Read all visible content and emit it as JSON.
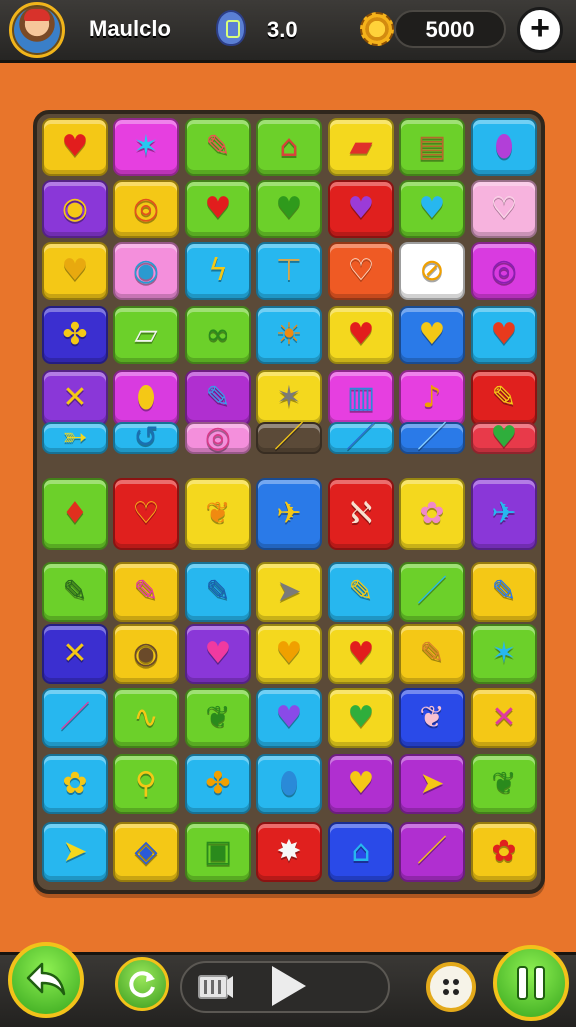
{
  "header": {
    "player_name": "Maulclo",
    "level_value": "3.0",
    "coin_value": "5000",
    "add_label": "+"
  },
  "icons": {
    "avatar": "player-avatar",
    "level": "level-badge-icon",
    "coin": "gear-coin-icon",
    "back": "back-arrow-icon",
    "refresh": "refresh-icon",
    "film": "film-icon",
    "play": "play-icon",
    "menu": "menu-dots-icon",
    "pause": "pause-icon"
  },
  "colors": {
    "background": "#e8752b",
    "board": "#5b4a38",
    "bar": "#2f2d2a",
    "button_green": "#4cbf2a",
    "button_rim": "#f2c21a"
  },
  "board": {
    "rows": [
      [
        {
          "c": "#f4c816",
          "g": "♥",
          "ic": "#e21d1d"
        },
        {
          "c": "#e63fe0",
          "g": "✶",
          "ic": "#27c8f0"
        },
        {
          "c": "#6cd02a",
          "g": "✎",
          "ic": "#ef5050"
        },
        {
          "c": "#6cd02a",
          "g": "⌂",
          "ic": "#d8433a"
        },
        {
          "c": "#f4d81e",
          "g": "▰",
          "ic": "#e0302a"
        },
        {
          "c": "#6cd02a",
          "g": "▤",
          "ic": "#b36a2c"
        },
        {
          "c": "#27b7ef",
          "g": "⬮",
          "ic": "#b23fd8"
        }
      ],
      [
        {
          "c": "#8a37d8",
          "g": "◉",
          "ic": "#f4c816"
        },
        {
          "c": "#f4c816",
          "g": "◎",
          "ic": "#e2521d"
        },
        {
          "c": "#6cd02a",
          "g": "♥",
          "ic": "#e21d1d"
        },
        {
          "c": "#6cd02a",
          "g": "♥",
          "ic": "#2f9a1c"
        },
        {
          "c": "#e0201e",
          "g": "♥",
          "ic": "#9b3bd8"
        },
        {
          "c": "#6cd02a",
          "g": "♥",
          "ic": "#27b7ef"
        },
        {
          "c": "#f7b3de",
          "g": "♡",
          "ic": "#f7e0e8"
        }
      ],
      [
        {
          "c": "#f4c816",
          "g": "♥",
          "ic": "#e8a90f"
        },
        {
          "c": "#f48fdc",
          "g": "◉",
          "ic": "#2a9ad0"
        },
        {
          "c": "#27b7ef",
          "g": "ϟ",
          "ic": "#f4c816"
        },
        {
          "c": "#27b7ef",
          "g": "⊤",
          "ic": "#d9a84c"
        },
        {
          "c": "#ef5a24",
          "g": "♡",
          "ic": "#f7e0d0"
        },
        {
          "c": "#ffffff",
          "g": "⊘",
          "ic": "#f0a000"
        },
        {
          "c": "#d93be0",
          "g": "◎",
          "ic": "#8a1fb0"
        }
      ],
      [
        {
          "c": "#3b2fd0",
          "g": "✤",
          "ic": "#f4c816"
        },
        {
          "c": "#6cd02a",
          "g": "▱",
          "ic": "#f2f2f2"
        },
        {
          "c": "#6cd02a",
          "g": "∞",
          "ic": "#2a8a1c"
        },
        {
          "c": "#27b7ef",
          "g": "☀",
          "ic": "#f08a10"
        },
        {
          "c": "#f4d81e",
          "g": "♥",
          "ic": "#e21d1d"
        },
        {
          "c": "#2a7ae8",
          "g": "♥",
          "ic": "#f4c816"
        },
        {
          "c": "#27b7ef",
          "g": "♥",
          "ic": "#e83a1d"
        }
      ],
      [
        {
          "c": "#8a37d8",
          "g": "✕",
          "ic": "#f4c816"
        },
        {
          "c": "#d93be0",
          "g": "⬮",
          "ic": "#f4c816"
        },
        {
          "c": "#b02fd0",
          "g": "✎",
          "ic": "#3a9ae8"
        },
        {
          "c": "#f4d81e",
          "g": "✶",
          "ic": "#7a7a7a"
        },
        {
          "c": "#e63fe0",
          "g": "▥",
          "ic": "#2a8ad8"
        },
        {
          "c": "#e63fe0",
          "g": "♪",
          "ic": "#f0a000"
        },
        {
          "c": "#e0201e",
          "g": "✎",
          "ic": "#f4c816"
        }
      ],
      [
        {
          "c": "#27b7ef",
          "g": "➳",
          "ic": "#f4d81e"
        },
        {
          "c": "#27b7ef",
          "g": "↺",
          "ic": "#1a6fb0"
        },
        {
          "c": "#f48fdc",
          "g": "◎",
          "ic": "#d83a8a"
        },
        {
          "c": "#5b4a38",
          "g": "／",
          "ic": "#f4c816"
        },
        {
          "c": "#27b7ef",
          "g": "／",
          "ic": "#2a6ad0"
        },
        {
          "c": "#2a7ae8",
          "g": "／",
          "ic": "#8ad0ff"
        },
        {
          "c": "#e83a4a",
          "g": "♥",
          "ic": "#2fae3c"
        }
      ],
      [
        {
          "c": "#6cd02a",
          "g": "♦",
          "ic": "#e0301e"
        },
        {
          "c": "#e0201e",
          "g": "♡",
          "ic": "#f4c816"
        },
        {
          "c": "#f4d81e",
          "g": "❦",
          "ic": "#f08a10"
        },
        {
          "c": "#2a7ae8",
          "g": "✈",
          "ic": "#f4c816"
        },
        {
          "c": "#e0201e",
          "g": "ℵ",
          "ic": "#f7e0d0"
        },
        {
          "c": "#f4d81e",
          "g": "✿",
          "ic": "#f08ac8"
        },
        {
          "c": "#8a37d8",
          "g": "✈",
          "ic": "#27b7ef"
        }
      ],
      [
        {
          "c": "#6cd02a",
          "g": "✎",
          "ic": "#2a6a1c"
        },
        {
          "c": "#f4c816",
          "g": "✎",
          "ic": "#e03aa0"
        },
        {
          "c": "#27b7ef",
          "g": "✎",
          "ic": "#1a5fb0"
        },
        {
          "c": "#f4d81e",
          "g": "➤",
          "ic": "#7a7a7a"
        },
        {
          "c": "#27b7ef",
          "g": "✎",
          "ic": "#f4c816"
        },
        {
          "c": "#6cd02a",
          "g": "／",
          "ic": "#27b7ef"
        },
        {
          "c": "#f4c816",
          "g": "✎",
          "ic": "#2a7ae8"
        }
      ],
      [
        {
          "c": "#3b2fd0",
          "g": "✕",
          "ic": "#f4c816"
        },
        {
          "c": "#f4c816",
          "g": "◉",
          "ic": "#6a4a2a"
        },
        {
          "c": "#8a37d8",
          "g": "♥",
          "ic": "#f03aa0"
        },
        {
          "c": "#f4d81e",
          "g": "♥",
          "ic": "#f0a000"
        },
        {
          "c": "#f4d81e",
          "g": "♥",
          "ic": "#e21d1d"
        },
        {
          "c": "#f4c816",
          "g": "✎",
          "ic": "#d8822a"
        },
        {
          "c": "#6cd02a",
          "g": "✶",
          "ic": "#27b7ef"
        }
      ],
      [
        {
          "c": "#27b7ef",
          "g": "／",
          "ic": "#e03aa0"
        },
        {
          "c": "#6cd02a",
          "g": "∿",
          "ic": "#f4c816"
        },
        {
          "c": "#6cd02a",
          "g": "❦",
          "ic": "#2a8a1c"
        },
        {
          "c": "#27b7ef",
          "g": "♥",
          "ic": "#8a4ae8"
        },
        {
          "c": "#f4d81e",
          "g": "♥",
          "ic": "#2fae3c"
        },
        {
          "c": "#2a4ae8",
          "g": "❦",
          "ic": "#f7c0d0"
        },
        {
          "c": "#f4c816",
          "g": "✕",
          "ic": "#e03aa0"
        }
      ],
      [
        {
          "c": "#27b7ef",
          "g": "✿",
          "ic": "#f4c816"
        },
        {
          "c": "#6cd02a",
          "g": "⚲",
          "ic": "#f4c816"
        },
        {
          "c": "#27b7ef",
          "g": "✤",
          "ic": "#f0a000"
        },
        {
          "c": "#27b7ef",
          "g": "⬮",
          "ic": "#2a8ad8"
        },
        {
          "c": "#b02fd0",
          "g": "♥",
          "ic": "#f4c816"
        },
        {
          "c": "#b02fd0",
          "g": "➤",
          "ic": "#f4c816"
        },
        {
          "c": "#6cd02a",
          "g": "❦",
          "ic": "#2a8a1c"
        }
      ],
      [
        {
          "c": "#27b7ef",
          "g": "➤",
          "ic": "#f4d81e"
        },
        {
          "c": "#f4c816",
          "g": "◈",
          "ic": "#2a5ad8"
        },
        {
          "c": "#6cd02a",
          "g": "▣",
          "ic": "#2a8a1c"
        },
        {
          "c": "#e0201e",
          "g": "✸",
          "ic": "#f7f7f7"
        },
        {
          "c": "#2a4ae8",
          "g": "⌂",
          "ic": "#27b7ef"
        },
        {
          "c": "#b02fd0",
          "g": "／",
          "ic": "#f4c816"
        },
        {
          "c": "#f4c816",
          "g": "✿",
          "ic": "#e0201e"
        }
      ]
    ]
  }
}
